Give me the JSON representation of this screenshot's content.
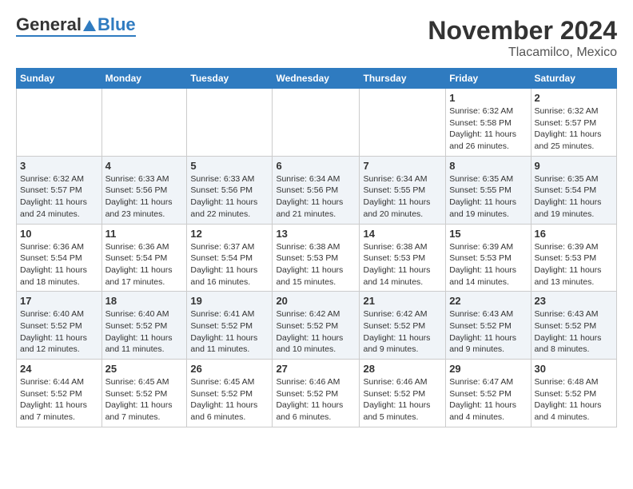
{
  "header": {
    "logo_general": "General",
    "logo_blue": "Blue",
    "title": "November 2024",
    "subtitle": "Tlacamilco, Mexico"
  },
  "weekdays": [
    "Sunday",
    "Monday",
    "Tuesday",
    "Wednesday",
    "Thursday",
    "Friday",
    "Saturday"
  ],
  "weeks": [
    [
      {
        "day": "",
        "info": ""
      },
      {
        "day": "",
        "info": ""
      },
      {
        "day": "",
        "info": ""
      },
      {
        "day": "",
        "info": ""
      },
      {
        "day": "",
        "info": ""
      },
      {
        "day": "1",
        "info": "Sunrise: 6:32 AM\nSunset: 5:58 PM\nDaylight: 11 hours\nand 26 minutes."
      },
      {
        "day": "2",
        "info": "Sunrise: 6:32 AM\nSunset: 5:57 PM\nDaylight: 11 hours\nand 25 minutes."
      }
    ],
    [
      {
        "day": "3",
        "info": "Sunrise: 6:32 AM\nSunset: 5:57 PM\nDaylight: 11 hours\nand 24 minutes."
      },
      {
        "day": "4",
        "info": "Sunrise: 6:33 AM\nSunset: 5:56 PM\nDaylight: 11 hours\nand 23 minutes."
      },
      {
        "day": "5",
        "info": "Sunrise: 6:33 AM\nSunset: 5:56 PM\nDaylight: 11 hours\nand 22 minutes."
      },
      {
        "day": "6",
        "info": "Sunrise: 6:34 AM\nSunset: 5:56 PM\nDaylight: 11 hours\nand 21 minutes."
      },
      {
        "day": "7",
        "info": "Sunrise: 6:34 AM\nSunset: 5:55 PM\nDaylight: 11 hours\nand 20 minutes."
      },
      {
        "day": "8",
        "info": "Sunrise: 6:35 AM\nSunset: 5:55 PM\nDaylight: 11 hours\nand 19 minutes."
      },
      {
        "day": "9",
        "info": "Sunrise: 6:35 AM\nSunset: 5:54 PM\nDaylight: 11 hours\nand 19 minutes."
      }
    ],
    [
      {
        "day": "10",
        "info": "Sunrise: 6:36 AM\nSunset: 5:54 PM\nDaylight: 11 hours\nand 18 minutes."
      },
      {
        "day": "11",
        "info": "Sunrise: 6:36 AM\nSunset: 5:54 PM\nDaylight: 11 hours\nand 17 minutes."
      },
      {
        "day": "12",
        "info": "Sunrise: 6:37 AM\nSunset: 5:54 PM\nDaylight: 11 hours\nand 16 minutes."
      },
      {
        "day": "13",
        "info": "Sunrise: 6:38 AM\nSunset: 5:53 PM\nDaylight: 11 hours\nand 15 minutes."
      },
      {
        "day": "14",
        "info": "Sunrise: 6:38 AM\nSunset: 5:53 PM\nDaylight: 11 hours\nand 14 minutes."
      },
      {
        "day": "15",
        "info": "Sunrise: 6:39 AM\nSunset: 5:53 PM\nDaylight: 11 hours\nand 14 minutes."
      },
      {
        "day": "16",
        "info": "Sunrise: 6:39 AM\nSunset: 5:53 PM\nDaylight: 11 hours\nand 13 minutes."
      }
    ],
    [
      {
        "day": "17",
        "info": "Sunrise: 6:40 AM\nSunset: 5:52 PM\nDaylight: 11 hours\nand 12 minutes."
      },
      {
        "day": "18",
        "info": "Sunrise: 6:40 AM\nSunset: 5:52 PM\nDaylight: 11 hours\nand 11 minutes."
      },
      {
        "day": "19",
        "info": "Sunrise: 6:41 AM\nSunset: 5:52 PM\nDaylight: 11 hours\nand 11 minutes."
      },
      {
        "day": "20",
        "info": "Sunrise: 6:42 AM\nSunset: 5:52 PM\nDaylight: 11 hours\nand 10 minutes."
      },
      {
        "day": "21",
        "info": "Sunrise: 6:42 AM\nSunset: 5:52 PM\nDaylight: 11 hours\nand 9 minutes."
      },
      {
        "day": "22",
        "info": "Sunrise: 6:43 AM\nSunset: 5:52 PM\nDaylight: 11 hours\nand 9 minutes."
      },
      {
        "day": "23",
        "info": "Sunrise: 6:43 AM\nSunset: 5:52 PM\nDaylight: 11 hours\nand 8 minutes."
      }
    ],
    [
      {
        "day": "24",
        "info": "Sunrise: 6:44 AM\nSunset: 5:52 PM\nDaylight: 11 hours\nand 7 minutes."
      },
      {
        "day": "25",
        "info": "Sunrise: 6:45 AM\nSunset: 5:52 PM\nDaylight: 11 hours\nand 7 minutes."
      },
      {
        "day": "26",
        "info": "Sunrise: 6:45 AM\nSunset: 5:52 PM\nDaylight: 11 hours\nand 6 minutes."
      },
      {
        "day": "27",
        "info": "Sunrise: 6:46 AM\nSunset: 5:52 PM\nDaylight: 11 hours\nand 6 minutes."
      },
      {
        "day": "28",
        "info": "Sunrise: 6:46 AM\nSunset: 5:52 PM\nDaylight: 11 hours\nand 5 minutes."
      },
      {
        "day": "29",
        "info": "Sunrise: 6:47 AM\nSunset: 5:52 PM\nDaylight: 11 hours\nand 4 minutes."
      },
      {
        "day": "30",
        "info": "Sunrise: 6:48 AM\nSunset: 5:52 PM\nDaylight: 11 hours\nand 4 minutes."
      }
    ]
  ]
}
